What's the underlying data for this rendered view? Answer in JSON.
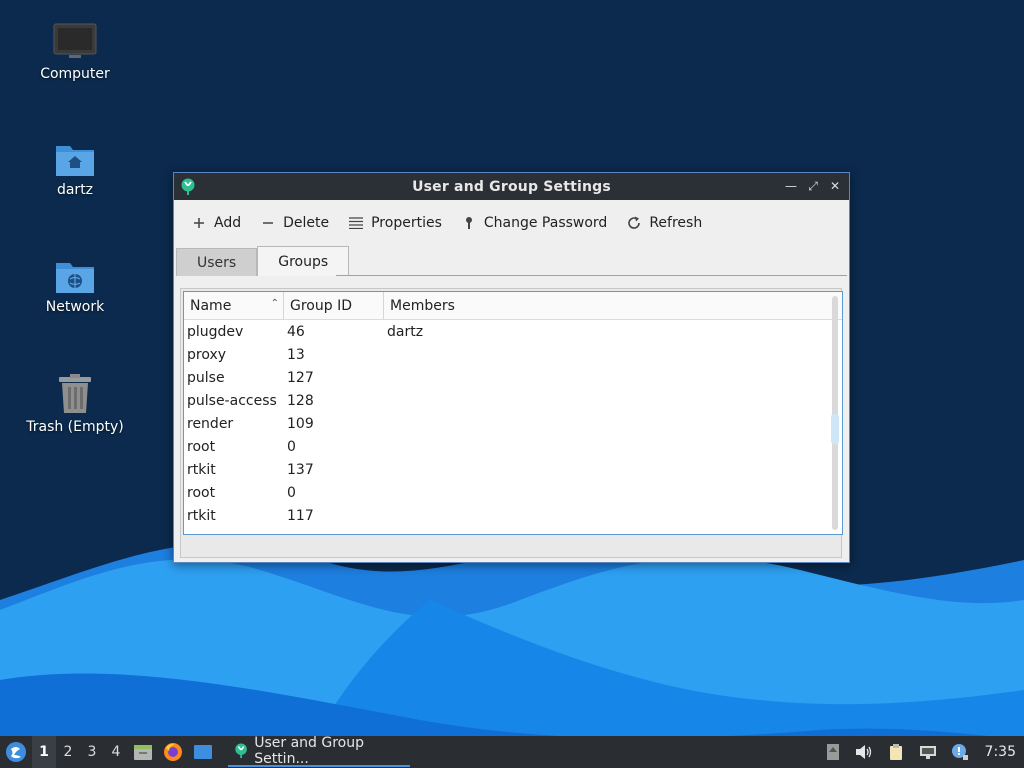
{
  "desktop": {
    "icons": [
      {
        "label": "Computer",
        "icon": "computer-icon"
      },
      {
        "label": "dartz",
        "icon": "home-folder-icon"
      },
      {
        "label": "Network",
        "icon": "network-folder-icon"
      },
      {
        "label": "Trash (Empty)",
        "icon": "trash-icon"
      }
    ]
  },
  "window": {
    "title": "User and Group Settings",
    "controls": [
      "minimize",
      "maximize",
      "close"
    ],
    "toolbar": {
      "add": "Add",
      "delete": "Delete",
      "properties": "Properties",
      "change_password": "Change Password",
      "refresh": "Refresh"
    },
    "tabs": [
      "Users",
      "Groups"
    ],
    "active_tab": "Groups",
    "table": {
      "columns": [
        "Name",
        "Group ID",
        "Members"
      ],
      "sort_column": "Name",
      "rows": [
        {
          "name": "plugdev",
          "gid": "46",
          "members": "dartz"
        },
        {
          "name": "proxy",
          "gid": "13",
          "members": ""
        },
        {
          "name": "pulse",
          "gid": "127",
          "members": ""
        },
        {
          "name": "pulse-access",
          "gid": "128",
          "members": ""
        },
        {
          "name": "render",
          "gid": "109",
          "members": ""
        },
        {
          "name": "root",
          "gid": "0",
          "members": ""
        },
        {
          "name": "rtkit",
          "gid": "137",
          "members": ""
        },
        {
          "name": "root",
          "gid": "0",
          "members": ""
        },
        {
          "name": "rtkit",
          "gid": "117",
          "members": ""
        }
      ]
    }
  },
  "taskbar": {
    "workspaces": [
      "1",
      "2",
      "3",
      "4"
    ],
    "current_workspace": "1",
    "task_label": "User and Group Settin...",
    "clock": "7:35"
  },
  "colors": {
    "desktop_bg": "#0b2a4d",
    "wave_light": "#2ea0f2",
    "wave_dark": "#0f6fd6",
    "titlebar": "#2b2f36",
    "window_border": "#5b86c0",
    "taskbar": "#2a2e33"
  }
}
